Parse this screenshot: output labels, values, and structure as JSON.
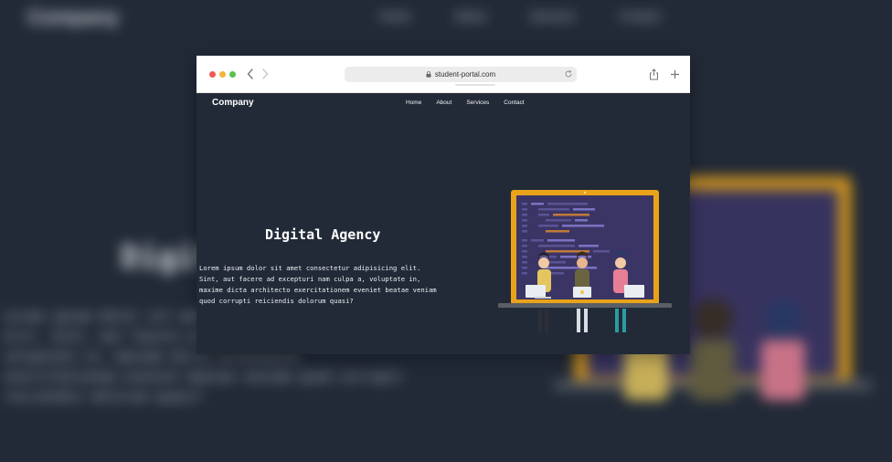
{
  "site": {
    "logo": "Company",
    "nav": [
      {
        "label": "Home"
      },
      {
        "label": "About"
      },
      {
        "label": "Services"
      },
      {
        "label": "Contact"
      }
    ],
    "hero": {
      "title": "Digital Agency",
      "text": "Lorem ipsum dolor sit amet consectetur adipisicing elit. Sint, aut facere ad excepturi nam culpa a, voluptate in, maxime dicta architecto exercitationem eveniet beatae veniam quod corrupti reiciendis dolorum quasi?"
    }
  },
  "browser": {
    "url": "student-portal.com",
    "icons": [
      "close-dot",
      "minimize-dot",
      "maximize-dot",
      "back-arrow-icon",
      "forward-arrow-icon",
      "lock-icon",
      "reload-icon",
      "share-icon",
      "new-tab-icon"
    ]
  },
  "colors": {
    "page_background": "#222a37",
    "laptop_frame": "#e8a31a",
    "screen": "#3b3566"
  }
}
